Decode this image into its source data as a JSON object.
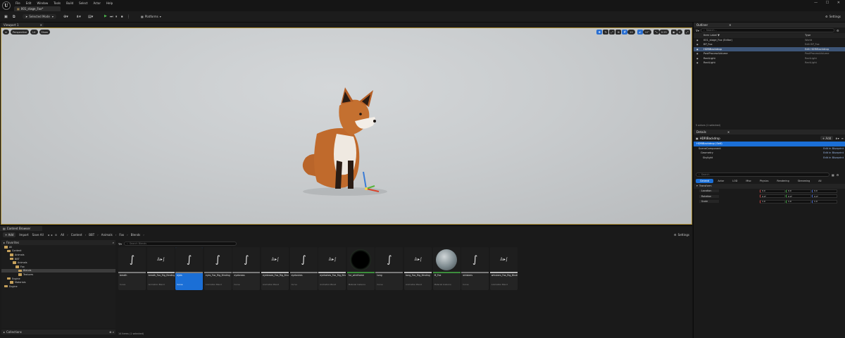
{
  "menu": {
    "logo": "U",
    "items": [
      "File",
      "Edit",
      "Window",
      "Tools",
      "Build",
      "Select",
      "Actor",
      "Help"
    ]
  },
  "map_tab": {
    "label": "001_stage_Fox*"
  },
  "toolbar": {
    "save": "▣",
    "mode_label": "Selected Mode",
    "platforms": "Platforms",
    "settings": "Settings"
  },
  "viewport": {
    "tab": "Viewport 1",
    "perspective": "Perspective",
    "lit": "Lit",
    "show": "Show",
    "right_values": [
      "10",
      "10°",
      "0.25",
      "4"
    ]
  },
  "outliner": {
    "tab": "Outliner",
    "search_placeholder": "Search...",
    "col_label": "Item Label ▼",
    "col_type": "Type",
    "rows": [
      {
        "label": "001_stage_Fox (Editor)",
        "type": "World",
        "indent": 0,
        "selected": false
      },
      {
        "label": "BP_Fox",
        "type": "Edit BP_Fox",
        "indent": 1,
        "selected": false
      },
      {
        "label": "HDRIBackdrop",
        "type": "Edit HDRIBackdrop",
        "indent": 1,
        "selected": true
      },
      {
        "label": "PostProcessVolume",
        "type": "PostProcessVolume",
        "indent": 1,
        "selected": false
      },
      {
        "label": "RectLight",
        "type": "RectLight",
        "indent": 1,
        "selected": false
      },
      {
        "label": "RectLight",
        "type": "RectLight",
        "indent": 1,
        "selected": false
      }
    ],
    "footer": "5 actors (1 selected)"
  },
  "details": {
    "tab": "Details",
    "title": "HDRIBackdrop",
    "add_label": "+ Add",
    "components": [
      {
        "label": "HDRIBackdrop (Self)",
        "link": "",
        "selected": true
      },
      {
        "label": "SceneComponent",
        "link": "Edit in Blueprint",
        "selected": false
      },
      {
        "label": "Geometry",
        "link": "Edit in Blueprint",
        "selected": false
      },
      {
        "label": "Skylight",
        "link": "Edit in Blueprint",
        "selected": false
      }
    ],
    "search_placeholder": "Search",
    "tabs": [
      "General",
      "Actor",
      "LOD",
      "Misc",
      "Physics",
      "Rendering",
      "Streaming",
      "All"
    ],
    "section": "Transform",
    "transform": [
      {
        "label": "Location",
        "values": [
          "0.0",
          "0.0",
          "0.0"
        ]
      },
      {
        "label": "Rotation",
        "values": [
          "0.0°",
          "0.0°",
          "0.0°"
        ]
      },
      {
        "label": "Scale",
        "values": [
          "1.0",
          "1.0",
          "1.0"
        ]
      }
    ]
  },
  "content_browser": {
    "tab": "Content Browser",
    "add": "+ Add",
    "import": "Import",
    "save_all": "Save All",
    "breadcrumb": [
      "All",
      "Content",
      "BBT",
      "Animals",
      "Fox",
      "Blends"
    ],
    "settings": "Settings",
    "favorites": "Favorites",
    "project": "Fox",
    "search_placeholder": "Search Blends",
    "tree": [
      {
        "label": "All",
        "indent": 0,
        "selected": false
      },
      {
        "label": "Content",
        "indent": 1,
        "selected": false
      },
      {
        "label": "Animals",
        "indent": 2,
        "selected": false
      },
      {
        "label": "BBT",
        "indent": 2,
        "selected": false
      },
      {
        "label": "Animals",
        "indent": 3,
        "selected": false
      },
      {
        "label": "Fox",
        "indent": 4,
        "selected": false
      },
      {
        "label": "Blends",
        "indent": 5,
        "selected": true
      },
      {
        "label": "Textures",
        "indent": 5,
        "selected": false
      },
      {
        "label": "Engine",
        "indent": 1,
        "selected": false
      },
      {
        "label": "Materials",
        "indent": 2,
        "selected": false
      },
      {
        "label": "Engine",
        "indent": 0,
        "selected": false
      }
    ],
    "collections": "Collections",
    "assets": [
      {
        "name": "breath",
        "type": "Curve",
        "icon": "curve"
      },
      {
        "name": "breath_Fox_Rig_Binding",
        "type": "Animation Blend",
        "icon": "blend"
      },
      {
        "name": "eyes",
        "type": "Curve",
        "icon": "curve",
        "selected": true
      },
      {
        "name": "eyes_Fox_Rig_Binding",
        "type": "Animation Blend",
        "icon": "curve"
      },
      {
        "name": "eyebrows",
        "type": "Curve",
        "icon": "curve"
      },
      {
        "name": "eyebrows_Fox_Rig_Binding",
        "type": "Animation Blend",
        "icon": "blend"
      },
      {
        "name": "eyelashes",
        "type": "Curve",
        "icon": "curve"
      },
      {
        "name": "eyelashes_Fox_Rig_Binding",
        "type": "Animation Blend",
        "icon": "blend"
      },
      {
        "name": "fur_wireframe",
        "type": "Material Instance",
        "icon": "sphere-dark"
      },
      {
        "name": "tong",
        "type": "Curve",
        "icon": "curve"
      },
      {
        "name": "tong_Fox_Rig_Binding",
        "type": "Animation Blend",
        "icon": "blend"
      },
      {
        "name": "M_Fox",
        "type": "Material Instance",
        "icon": "sphere-light"
      },
      {
        "name": "whiskers",
        "type": "Curve",
        "icon": "curve"
      },
      {
        "name": "whiskers_Fox_Rig_Binding",
        "type": "Animation Blend",
        "icon": "blend"
      }
    ],
    "footer": "14 items (1 selected)"
  }
}
